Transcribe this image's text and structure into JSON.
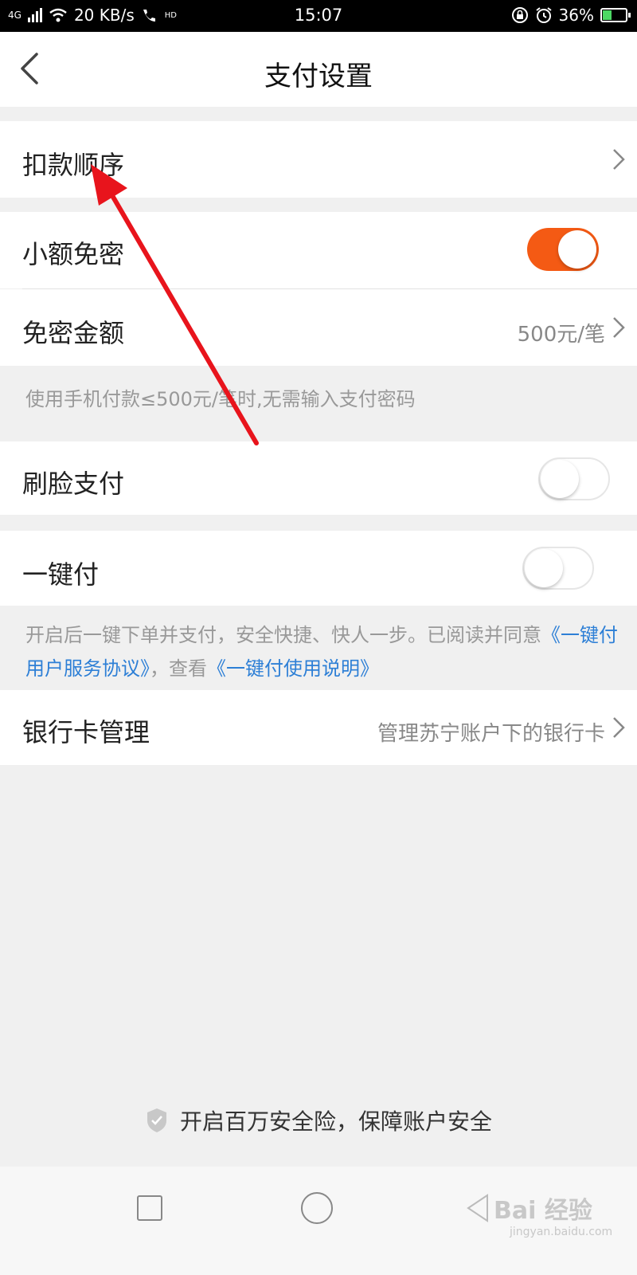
{
  "status_bar": {
    "network": "4G",
    "speed": "20 KB/s",
    "call_badge": "HD",
    "time": "15:07",
    "battery": "36%",
    "battery_level": 0.36
  },
  "header": {
    "title": "支付设置"
  },
  "rows": {
    "deduct_order": {
      "label": "扣款顺序"
    },
    "small_free": {
      "label": "小额免密",
      "enabled": true
    },
    "free_amount": {
      "label": "免密金额",
      "value": "500元/笔"
    },
    "free_amount_note": "使用手机付款≤500元/笔时,无需输入支付密码",
    "face_pay": {
      "label": "刷脸支付",
      "enabled": false
    },
    "one_click": {
      "label": "一键付",
      "enabled": false
    },
    "one_click_note": {
      "prefix": "开启后一键下单并支付，安全快捷、快人一步。已阅读并同意",
      "link1": "《一键付用户服务协议》",
      "middle": "，查看",
      "link2": "《一键付使用说明》"
    },
    "bank_card": {
      "label": "银行卡管理",
      "value": "管理苏宁账户下的银行卡"
    }
  },
  "insurance_text": "开启百万安全险，保障账户安全",
  "watermark": {
    "main": "Bai 经验",
    "sub": "jingyan.baidu.com"
  },
  "colors": {
    "accent": "#f45a14",
    "link": "#2d7fd6",
    "annotation_arrow": "#e8141c"
  }
}
